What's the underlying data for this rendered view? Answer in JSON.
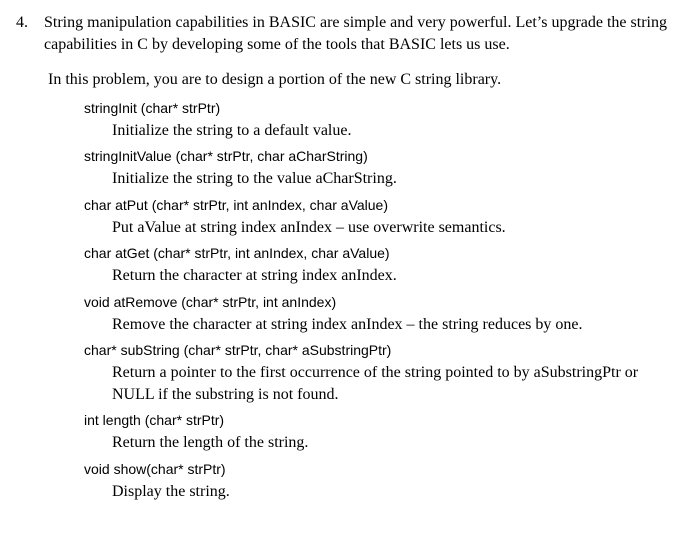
{
  "question": {
    "number": "4.",
    "intro": "String manipulation capabilities in BASIC are simple and very powerful.  Let’s upgrade the string capabilities in C by developing some of the tools that BASIC lets us use.",
    "lead": "In this problem, you are to design a portion of the new C string library."
  },
  "funcs": [
    {
      "sig": "stringInit (char* strPtr)",
      "desc": "Initialize the string to a default value."
    },
    {
      "sig": "stringInitValue (char* strPtr, char aCharString)",
      "desc": "Initialize the string to the value aCharString."
    },
    {
      "sig": "char atPut (char* strPtr, int anIndex, char aValue)",
      "desc": "Put aValue at string index anIndex – use overwrite semantics."
    },
    {
      "sig": "char atGet (char* strPtr, int anIndex, char aValue)",
      "desc": "Return the character at string index anIndex."
    },
    {
      "sig": "void atRemove (char* strPtr, int anIndex)",
      "desc": "Remove the character at string index anIndex – the string reduces by one."
    },
    {
      "sig": "char* subString (char* strPtr, char* aSubstringPtr)",
      "desc": "Return a pointer to the first occurrence of the string pointed to by aSubstringPtr or NULL if the substring is not found."
    },
    {
      "sig": "int length (char* strPtr)",
      "desc": "Return the length of the string."
    },
    {
      "sig": "void show(char* strPtr)",
      "desc": "Display the string."
    }
  ]
}
